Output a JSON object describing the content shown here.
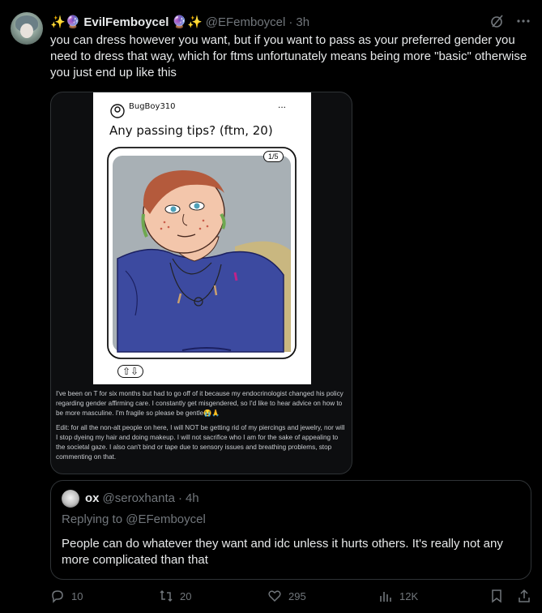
{
  "post": {
    "display_name": "EvilFemboycel",
    "name_emoji_left": "✨🔮",
    "name_emoji_right": "🔮✨",
    "handle": "@EFemboycel",
    "separator": "·",
    "time": "3h",
    "text": "you can dress however you want, but if you want to pass as your preferred gender you need to dress that way, which for ftms unfortunately means being more \"basic\" otherwise you just end up like this"
  },
  "media": {
    "username": "BugBoy310",
    "menu": "...",
    "title": "Any passing tips? (ftm, 20)",
    "page_indicator": "1/5",
    "vote_glyph": "⇧⇩",
    "caption_1": "I've been on T for six months but had to go off of it because my endocrinologist changed his policy regarding gender affirming care. I constantly get misgendered, so I'd like to hear advice on how to be more masculine. I'm fragile so please be gentle😭🙏",
    "caption_2": "Edit: for all the non-alt people on here, I will NOT be getting rid of my piercings and jewelry, nor will I stop dyeing my hair and doing makeup. I will not sacrifice who I am for the sake of appealing to the societal gaze. I also can't bind or tape due to sensory issues and breathing problems, stop commenting on that."
  },
  "quote": {
    "display_name": "ox",
    "handle": "@seroxhanta",
    "separator": "·",
    "time": "4h",
    "replying_to": "Replying to @EFemboycel",
    "text": "People can do whatever they want and idc unless it hurts others. It's really not any more complicated than that"
  },
  "actions": {
    "replies": "10",
    "reposts": "20",
    "likes": "295",
    "views": "12K"
  },
  "colors": {
    "background": "#000000",
    "text": "#e7e9ea",
    "muted": "#71767b",
    "border": "#2f3336"
  }
}
